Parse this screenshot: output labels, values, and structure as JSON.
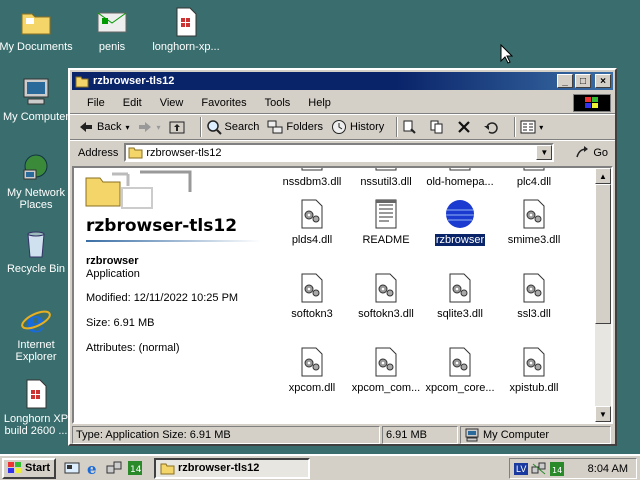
{
  "desktop": {
    "icons": [
      {
        "label": "My Documents"
      },
      {
        "label": "penis"
      },
      {
        "label": "longhorn-xp..."
      },
      {
        "label": "My Computer"
      },
      {
        "label": "My Network Places"
      },
      {
        "label": "Recycle Bin"
      },
      {
        "label": "Internet Explorer"
      },
      {
        "label": "Longhorn XP build 2600 ..."
      }
    ]
  },
  "window": {
    "title": "rzbrowser-tls12",
    "controls": {
      "minimize": "_",
      "maximize": "□",
      "close": "×"
    },
    "menu": [
      "File",
      "Edit",
      "View",
      "Favorites",
      "Tools",
      "Help"
    ],
    "toolbar": {
      "back": "Back",
      "search": "Search",
      "folders": "Folders",
      "history": "History"
    },
    "address": {
      "label": "Address",
      "value": "rzbrowser-tls12",
      "go": "Go"
    },
    "left_pane": {
      "title": "rzbrowser-tls12",
      "name": "rzbrowser",
      "type": "Application",
      "modified": "Modified: 12/11/2022 10:25 PM",
      "size": "Size: 6.91 MB",
      "attributes": "Attributes: (normal)"
    },
    "files": [
      {
        "name": "nssdbm3.dll"
      },
      {
        "name": "nssutil3.dll"
      },
      {
        "name": "old-homepa..."
      },
      {
        "name": "plc4.dll"
      },
      {
        "name": "plds4.dll"
      },
      {
        "name": "README"
      },
      {
        "name": "rzbrowser"
      },
      {
        "name": "smime3.dll"
      },
      {
        "name": "softokn3"
      },
      {
        "name": "softokn3.dll"
      },
      {
        "name": "sqlite3.dll"
      },
      {
        "name": "ssl3.dll"
      },
      {
        "name": "xpcom.dll"
      },
      {
        "name": "xpcom_com..."
      },
      {
        "name": "xpcom_core..."
      },
      {
        "name": "xpistub.dll"
      }
    ],
    "status": {
      "info": "Type: Application Size: 6.91 MB",
      "size": "6.91 MB",
      "zone": "My Computer"
    }
  },
  "taskbar": {
    "start": "Start",
    "task": "rzbrowser-tls12",
    "tray_lang": "LV",
    "clock": "8:04 AM"
  }
}
